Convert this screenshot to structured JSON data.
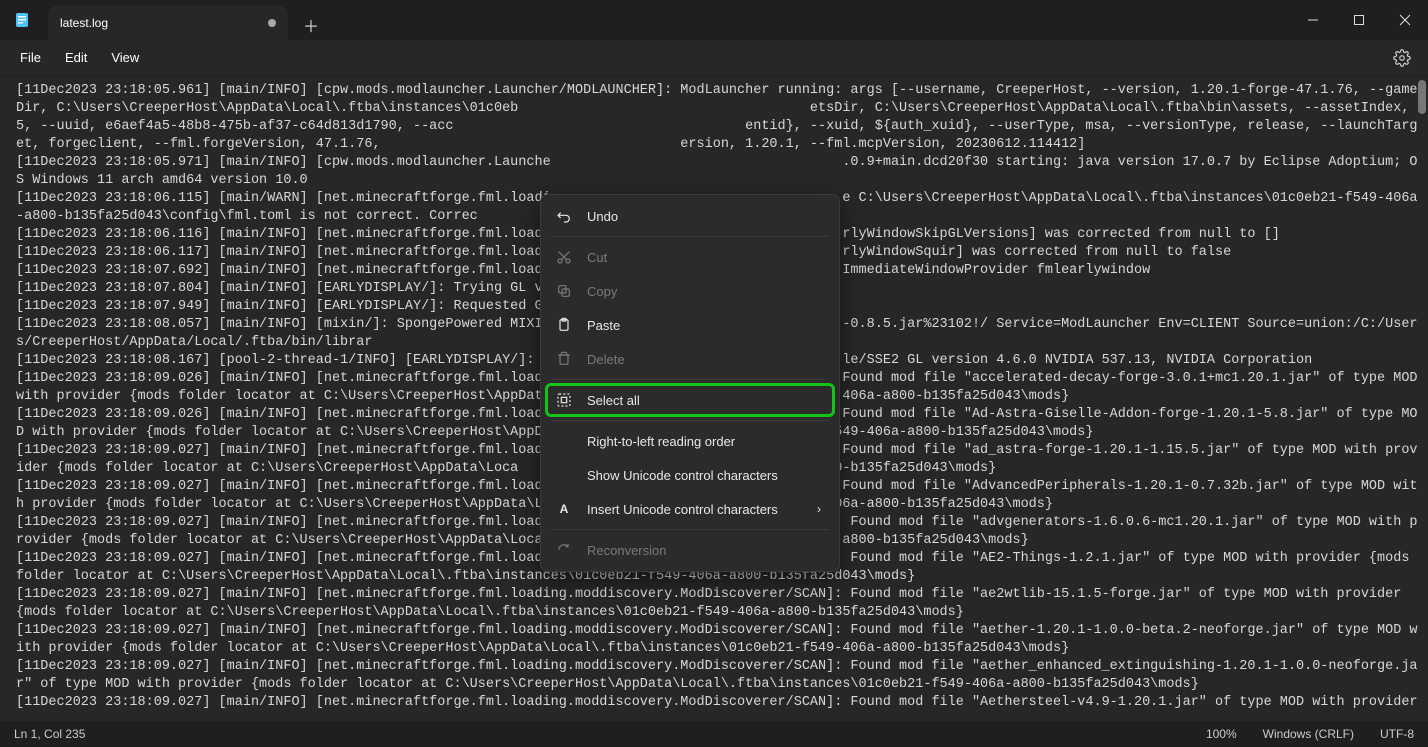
{
  "titlebar": {
    "tab_title": "latest.log"
  },
  "menubar": {
    "file": "File",
    "edit": "Edit",
    "view": "View"
  },
  "context_menu": {
    "undo": "Undo",
    "cut": "Cut",
    "copy": "Copy",
    "paste": "Paste",
    "delete": "Delete",
    "select_all": "Select all",
    "rtl": "Right-to-left reading order",
    "show_unicode": "Show Unicode control characters",
    "insert_unicode": "Insert Unicode control characters",
    "reconversion": "Reconversion"
  },
  "statusbar": {
    "position": "Ln 1, Col 235",
    "zoom": "100%",
    "eol": "Windows (CRLF)",
    "encoding": "UTF-8"
  },
  "icons": {
    "undo": "undo-icon",
    "cut": "cut-icon",
    "copy": "copy-icon",
    "paste": "paste-icon",
    "delete": "delete-icon",
    "select_all": "select-all-icon",
    "ime": "ime-icon",
    "gear": "gear-icon",
    "minimize": "minimize-icon",
    "maximize": "maximize-icon",
    "close": "close-icon",
    "newtab": "newtab-icon",
    "app": "notepad-app-icon"
  },
  "log": {
    "lines": [
      "[11Dec2023 23:18:05.961] [main/INFO] [cpw.mods.modlauncher.Launcher/MODLAUNCHER]: ModLauncher running: args [--username, CreeperHost, --version, 1.20.1-forge-47.1.76, --gameDir, C:\\Users\\CreeperHost\\AppData\\Local\\.ftba\\instances\\01c0eb                                    etsDir, C:\\Users\\CreeperHost\\AppData\\Local\\.ftba\\bin\\assets, --assetIndex, 5, --uuid, e6aef4a5-48b8-475b-af37-c64d813d1790, --acc                                    entid}, --xuid, ${auth_xuid}, --userType, msa, --versionType, release, --launchTarget, forgeclient, --fml.forgeVersion, 47.1.76,                                     ersion, 1.20.1, --fml.mcpVersion, 20230612.114412]",
      "[11Dec2023 23:18:05.971] [main/INFO] [cpw.mods.modlauncher.Launche                                    .0.9+main.dcd20f30 starting: java version 17.0.7 by Eclipse Adoptium; OS Windows 11 arch amd64 version 10.0",
      "[11Dec2023 23:18:06.115] [main/WARN] [net.minecraftforge.fml.loadi                                    e C:\\Users\\CreeperHost\\AppData\\Local\\.ftba\\instances\\01c0eb21-f549-406a-a800-b135fa25d043\\config\\fml.toml is not correct. Correc",
      "[11Dec2023 23:18:06.116] [main/INFO] [net.minecraftforge.fml.loadi                                    rlyWindowSkipGLVersions] was corrected from null to []",
      "[11Dec2023 23:18:06.117] [main/INFO] [net.minecraftforge.fml.loadi                                    rlyWindowSquir] was corrected from null to false",
      "[11Dec2023 23:18:07.692] [main/INFO] [net.minecraftforge.fml.loadi                                    ImmediateWindowProvider fmlearlywindow",
      "[11Dec2023 23:18:07.804] [main/INFO] [EARLYDISPLAY/]: Trying GL ve",
      "[11Dec2023 23:18:07.949] [main/INFO] [EARLYDISPLAY/]: Requested GL",
      "[11Dec2023 23:18:08.057] [main/INFO] [mixin/]: SpongePowered MIXIN                                    -0.8.5.jar%23102!/ Service=ModLauncher Env=CLIENT Source=union:/C:/Users/CreeperHost/AppData/Local/.ftba/bin/librar",
      "[11Dec2023 23:18:08.167] [pool-2-thread-1/INFO] [EARLYDISPLAY/]: G                                    le/SSE2 GL version 4.6.0 NVIDIA 537.13, NVIDIA Corporation",
      "[11Dec2023 23:18:09.026] [main/INFO] [net.minecraftforge.fml.loadi                                    Found mod file \"accelerated-decay-forge-3.0.1+mc1.20.1.jar\" of type MOD with provider {mods folder locator at C:\\Users\\CreeperHost\\AppData                                    406a-a800-b135fa25d043\\mods}",
      "[11Dec2023 23:18:09.026] [main/INFO] [net.minecraftforge.fml.loadi                                    Found mod file \"Ad-Astra-Giselle-Addon-forge-1.20.1-5.8.jar\" of type MOD with provider {mods folder locator at C:\\Users\\CreeperHost\\AppD                                    549-406a-a800-b135fa25d043\\mods}",
      "[11Dec2023 23:18:09.027] [main/INFO] [net.minecraftforge.fml.loadi                                    Found mod file \"ad_astra-forge-1.20.1-1.15.5.jar\" of type MOD with provider {mods folder locator at C:\\Users\\CreeperHost\\AppData\\Loca                                    a800-b135fa25d043\\mods}",
      "[11Dec2023 23:18:09.027] [main/INFO] [net.minecraftforge.fml.loadi                                    Found mod file \"AdvancedPeripherals-1.20.1-0.7.32b.jar\" of type MOD with provider {mods folder locator at C:\\Users\\CreeperHost\\AppData\\Local\\.ftba\\instances\\01c0eb21-f549-406a-a800-b135fa25d043\\mods}",
      "[11Dec2023 23:18:09.027] [main/INFO] [net.minecraftforge.fml.loading.moddiscovery.ModDiscoverer/SCAN]: Found mod file \"advgenerators-1.6.0.6-mc1.20.1.jar\" of type MOD with provider {mods folder locator at C:\\Users\\CreeperHost\\AppData\\Local\\.ftba\\instances\\01c0eb21-f549-406a-a800-b135fa25d043\\mods}",
      "[11Dec2023 23:18:09.027] [main/INFO] [net.minecraftforge.fml.loading.moddiscovery.ModDiscoverer/SCAN]: Found mod file \"AE2-Things-1.2.1.jar\" of type MOD with provider {mods folder locator at C:\\Users\\CreeperHost\\AppData\\Local\\.ftba\\instances\\01c0eb21-f549-406a-a800-b135fa25d043\\mods}",
      "[11Dec2023 23:18:09.027] [main/INFO] [net.minecraftforge.fml.loading.moddiscovery.ModDiscoverer/SCAN]: Found mod file \"ae2wtlib-15.1.5-forge.jar\" of type MOD with provider {mods folder locator at C:\\Users\\CreeperHost\\AppData\\Local\\.ftba\\instances\\01c0eb21-f549-406a-a800-b135fa25d043\\mods}",
      "[11Dec2023 23:18:09.027] [main/INFO] [net.minecraftforge.fml.loading.moddiscovery.ModDiscoverer/SCAN]: Found mod file \"aether-1.20.1-1.0.0-beta.2-neoforge.jar\" of type MOD with provider {mods folder locator at C:\\Users\\CreeperHost\\AppData\\Local\\.ftba\\instances\\01c0eb21-f549-406a-a800-b135fa25d043\\mods}",
      "[11Dec2023 23:18:09.027] [main/INFO] [net.minecraftforge.fml.loading.moddiscovery.ModDiscoverer/SCAN]: Found mod file \"aether_enhanced_extinguishing-1.20.1-1.0.0-neoforge.jar\" of type MOD with provider {mods folder locator at C:\\Users\\CreeperHost\\AppData\\Local\\.ftba\\instances\\01c0eb21-f549-406a-a800-b135fa25d043\\mods}",
      "[11Dec2023 23:18:09.027] [main/INFO] [net.minecraftforge.fml.loading.moddiscovery.ModDiscoverer/SCAN]: Found mod file \"Aethersteel-v4.9-1.20.1.jar\" of type MOD with provider"
    ]
  }
}
